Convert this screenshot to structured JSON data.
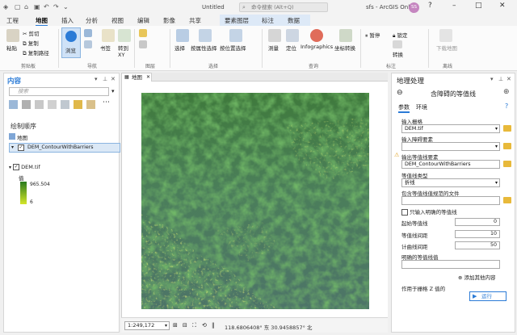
{
  "titlebar": {
    "doc_title": "Untitled",
    "search_placeholder": "命令搜索 (Alt+Q)",
    "account": "sfs - ArcGIS Online",
    "avatar_initials": "SS"
  },
  "ribbon_tabs": [
    "工程",
    "地图",
    "插入",
    "分析",
    "视图",
    "编辑",
    "影像",
    "共享",
    "要素图层",
    "标注",
    "数据"
  ],
  "ribbon": {
    "clipboard": {
      "paste": "粘贴",
      "cut": "剪切",
      "copy": "复制",
      "copy_path": "复制路径",
      "group": "剪贴板"
    },
    "navigate": {
      "explore": "浏览",
      "bookmarks": "书签",
      "goto": "转到",
      "goto_xy": "XY",
      "group": "导航"
    },
    "layer": {
      "group": "图层"
    },
    "selection": {
      "select": "选择",
      "by_attr": "按属性选择",
      "by_location": "按位置选择",
      "group": "选择"
    },
    "inquiry": {
      "measure": "测量",
      "locate": "定位",
      "infographics": "Infographics",
      "convert_coords": "坐标转换",
      "group": "查询"
    },
    "labeling": {
      "pause": "暂停",
      "lock": "锁定",
      "convert": "转换",
      "group": "标注"
    },
    "offline": {
      "download": "下载地图",
      "group": "离线"
    }
  },
  "contents": {
    "title": "内容",
    "search_placeholder": "搜索",
    "draw_order": "绘制顺序",
    "map_item": "地图",
    "layer_contour": "DEM_ContourWithBarriers",
    "layer_dem": "DEM.tif",
    "legend_heading": "值",
    "legend_high": "965.504",
    "legend_low": "6"
  },
  "map": {
    "tab_label": "地图",
    "scale": "1:249,172",
    "coordinates": "118.6806408° 东 30.9458857° 北"
  },
  "geoprocessing": {
    "pane_title": "地理处理",
    "tool_title": "含障碍的等值线",
    "tabs": [
      "参数",
      "环境"
    ],
    "input_raster_label": "输入栅格",
    "input_raster_value": "DEM.tif",
    "input_barrier_label": "输入障碍要素",
    "output_label": "输出等值线要素",
    "output_value": "DEM_ContourWithBarriers",
    "contour_type_label": "等值线类型",
    "contour_type_value": "折线",
    "explicit_file_label": "包含等值线值规范的文件",
    "explicit_only_label": "只输入明确的等值线",
    "base_label": "起始等值线",
    "base_value": "0",
    "interval_label": "等值线间距",
    "interval_value": "10",
    "index_label": "计曲线间距",
    "index_value": "50",
    "explicit_values_label": "明确的等值线值",
    "add_more_label": "添加其他内容",
    "z_factor_label": "作用于栅格 Z 值的",
    "run_label": "运行"
  },
  "colors": {
    "accent": "#2b7bd6",
    "legend_top": "#2a7b1e",
    "legend_bottom": "#d4e62a",
    "raster_base": "#4a7d52"
  }
}
